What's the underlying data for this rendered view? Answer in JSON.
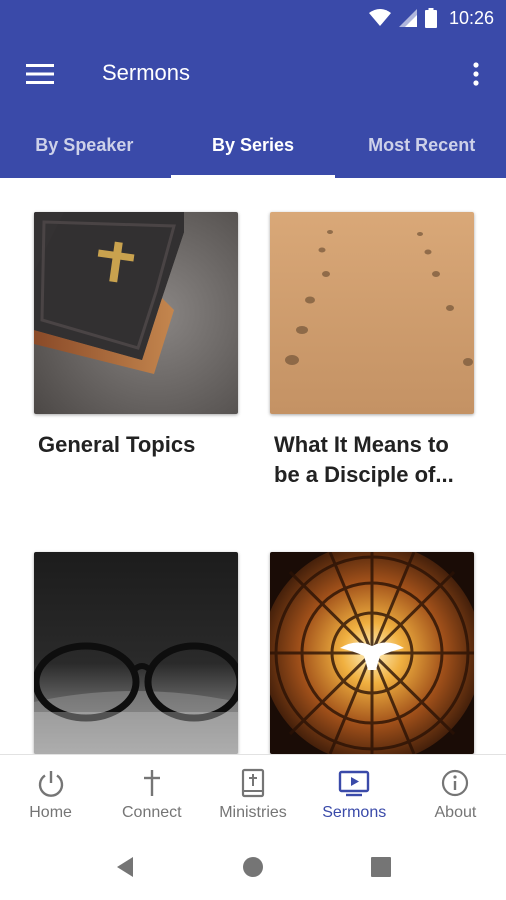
{
  "status_bar": {
    "time": "10:26"
  },
  "app_bar": {
    "title": "Sermons"
  },
  "tabs": [
    {
      "label": "By Speaker",
      "active": false
    },
    {
      "label": "By Series",
      "active": true
    },
    {
      "label": "Most Recent",
      "active": false
    }
  ],
  "series": [
    {
      "title": "General Topics",
      "image": "bible-image"
    },
    {
      "title": "What It Means to be a Disciple of...",
      "image": "footprints-image"
    },
    {
      "title": "",
      "image": "glasses-book-image"
    },
    {
      "title": "",
      "image": "stained-glass-dove-image"
    }
  ],
  "bottom_nav": [
    {
      "label": "Home",
      "icon": "power-icon",
      "active": false
    },
    {
      "label": "Connect",
      "icon": "cross-icon",
      "active": false
    },
    {
      "label": "Ministries",
      "icon": "bible-icon",
      "active": false
    },
    {
      "label": "Sermons",
      "icon": "video-icon",
      "active": true
    },
    {
      "label": "About",
      "icon": "info-icon",
      "active": false
    }
  ],
  "colors": {
    "primary": "#3a4aa9",
    "inactive": "#757575"
  }
}
